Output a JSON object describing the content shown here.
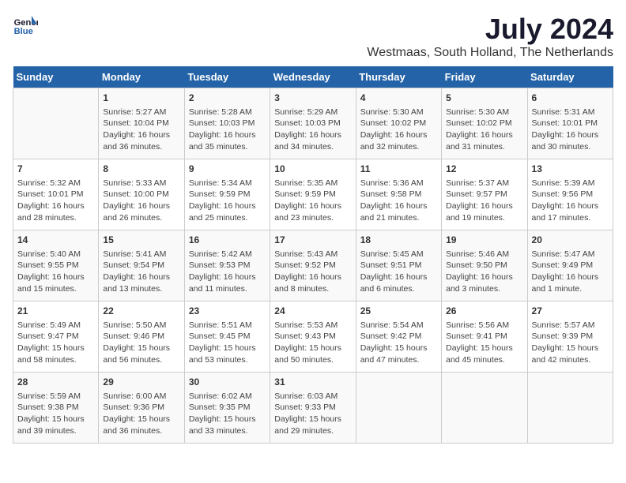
{
  "header": {
    "logo_line1": "General",
    "logo_line2": "Blue",
    "month": "July 2024",
    "location": "Westmaas, South Holland, The Netherlands"
  },
  "days_of_week": [
    "Sunday",
    "Monday",
    "Tuesday",
    "Wednesday",
    "Thursday",
    "Friday",
    "Saturday"
  ],
  "weeks": [
    [
      {
        "day": "",
        "content": ""
      },
      {
        "day": "1",
        "content": "Sunrise: 5:27 AM\nSunset: 10:04 PM\nDaylight: 16 hours\nand 36 minutes."
      },
      {
        "day": "2",
        "content": "Sunrise: 5:28 AM\nSunset: 10:03 PM\nDaylight: 16 hours\nand 35 minutes."
      },
      {
        "day": "3",
        "content": "Sunrise: 5:29 AM\nSunset: 10:03 PM\nDaylight: 16 hours\nand 34 minutes."
      },
      {
        "day": "4",
        "content": "Sunrise: 5:30 AM\nSunset: 10:02 PM\nDaylight: 16 hours\nand 32 minutes."
      },
      {
        "day": "5",
        "content": "Sunrise: 5:30 AM\nSunset: 10:02 PM\nDaylight: 16 hours\nand 31 minutes."
      },
      {
        "day": "6",
        "content": "Sunrise: 5:31 AM\nSunset: 10:01 PM\nDaylight: 16 hours\nand 30 minutes."
      }
    ],
    [
      {
        "day": "7",
        "content": "Sunrise: 5:32 AM\nSunset: 10:01 PM\nDaylight: 16 hours\nand 28 minutes."
      },
      {
        "day": "8",
        "content": "Sunrise: 5:33 AM\nSunset: 10:00 PM\nDaylight: 16 hours\nand 26 minutes."
      },
      {
        "day": "9",
        "content": "Sunrise: 5:34 AM\nSunset: 9:59 PM\nDaylight: 16 hours\nand 25 minutes."
      },
      {
        "day": "10",
        "content": "Sunrise: 5:35 AM\nSunset: 9:59 PM\nDaylight: 16 hours\nand 23 minutes."
      },
      {
        "day": "11",
        "content": "Sunrise: 5:36 AM\nSunset: 9:58 PM\nDaylight: 16 hours\nand 21 minutes."
      },
      {
        "day": "12",
        "content": "Sunrise: 5:37 AM\nSunset: 9:57 PM\nDaylight: 16 hours\nand 19 minutes."
      },
      {
        "day": "13",
        "content": "Sunrise: 5:39 AM\nSunset: 9:56 PM\nDaylight: 16 hours\nand 17 minutes."
      }
    ],
    [
      {
        "day": "14",
        "content": "Sunrise: 5:40 AM\nSunset: 9:55 PM\nDaylight: 16 hours\nand 15 minutes."
      },
      {
        "day": "15",
        "content": "Sunrise: 5:41 AM\nSunset: 9:54 PM\nDaylight: 16 hours\nand 13 minutes."
      },
      {
        "day": "16",
        "content": "Sunrise: 5:42 AM\nSunset: 9:53 PM\nDaylight: 16 hours\nand 11 minutes."
      },
      {
        "day": "17",
        "content": "Sunrise: 5:43 AM\nSunset: 9:52 PM\nDaylight: 16 hours\nand 8 minutes."
      },
      {
        "day": "18",
        "content": "Sunrise: 5:45 AM\nSunset: 9:51 PM\nDaylight: 16 hours\nand 6 minutes."
      },
      {
        "day": "19",
        "content": "Sunrise: 5:46 AM\nSunset: 9:50 PM\nDaylight: 16 hours\nand 3 minutes."
      },
      {
        "day": "20",
        "content": "Sunrise: 5:47 AM\nSunset: 9:49 PM\nDaylight: 16 hours\nand 1 minute."
      }
    ],
    [
      {
        "day": "21",
        "content": "Sunrise: 5:49 AM\nSunset: 9:47 PM\nDaylight: 15 hours\nand 58 minutes."
      },
      {
        "day": "22",
        "content": "Sunrise: 5:50 AM\nSunset: 9:46 PM\nDaylight: 15 hours\nand 56 minutes."
      },
      {
        "day": "23",
        "content": "Sunrise: 5:51 AM\nSunset: 9:45 PM\nDaylight: 15 hours\nand 53 minutes."
      },
      {
        "day": "24",
        "content": "Sunrise: 5:53 AM\nSunset: 9:43 PM\nDaylight: 15 hours\nand 50 minutes."
      },
      {
        "day": "25",
        "content": "Sunrise: 5:54 AM\nSunset: 9:42 PM\nDaylight: 15 hours\nand 47 minutes."
      },
      {
        "day": "26",
        "content": "Sunrise: 5:56 AM\nSunset: 9:41 PM\nDaylight: 15 hours\nand 45 minutes."
      },
      {
        "day": "27",
        "content": "Sunrise: 5:57 AM\nSunset: 9:39 PM\nDaylight: 15 hours\nand 42 minutes."
      }
    ],
    [
      {
        "day": "28",
        "content": "Sunrise: 5:59 AM\nSunset: 9:38 PM\nDaylight: 15 hours\nand 39 minutes."
      },
      {
        "day": "29",
        "content": "Sunrise: 6:00 AM\nSunset: 9:36 PM\nDaylight: 15 hours\nand 36 minutes."
      },
      {
        "day": "30",
        "content": "Sunrise: 6:02 AM\nSunset: 9:35 PM\nDaylight: 15 hours\nand 33 minutes."
      },
      {
        "day": "31",
        "content": "Sunrise: 6:03 AM\nSunset: 9:33 PM\nDaylight: 15 hours\nand 29 minutes."
      },
      {
        "day": "",
        "content": ""
      },
      {
        "day": "",
        "content": ""
      },
      {
        "day": "",
        "content": ""
      }
    ]
  ]
}
